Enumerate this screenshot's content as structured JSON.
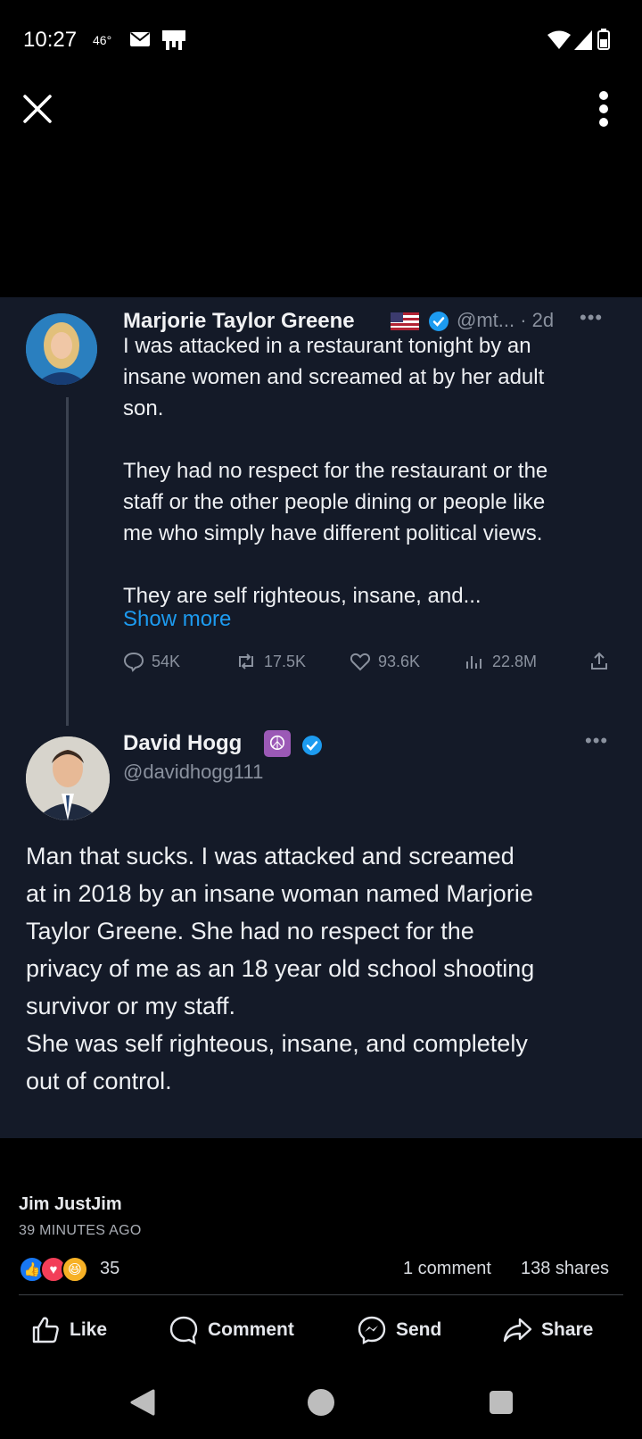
{
  "status_bar": {
    "time": "10:27",
    "temperature": "46°"
  },
  "tweet": {
    "author_name": "Marjorie Taylor Greene",
    "handle_time": "@mt... · 2d",
    "text": "I was attacked in a restaurant tonight by an\ninsane women and screamed at by her adult\nson.\n\nThey had no respect for the restaurant or the\nstaff or the other people dining or people like\nme who simply have different political views.\n\nThey are self righteous, insane, and...",
    "show_more": "Show more",
    "stats": {
      "replies": "54K",
      "retweets": "17.5K",
      "likes": "93.6K",
      "views": "22.8M"
    }
  },
  "reply": {
    "author_name": "David Hogg",
    "handle": "@davidhogg111",
    "text": "Man that sucks. I was attacked and screamed\nat in 2018 by an insane woman named Marjorie\nTaylor Greene. She had no respect for the\nprivacy of me as an 18 year old school shooting\nsurvivor or my staff.\nShe was self righteous, insane, and completely\nout of control."
  },
  "post": {
    "poster": "Jim JustJim",
    "time": "39 MINUTES AGO",
    "reaction_count": "35",
    "comments": "1 comment",
    "shares": "138 shares"
  },
  "actions": {
    "like": "Like",
    "comment": "Comment",
    "send": "Send",
    "share": "Share"
  },
  "colors": {
    "card_background": "#141a28",
    "link_blue": "#1d9bf0",
    "verified_blue": "#1d9bf0"
  }
}
